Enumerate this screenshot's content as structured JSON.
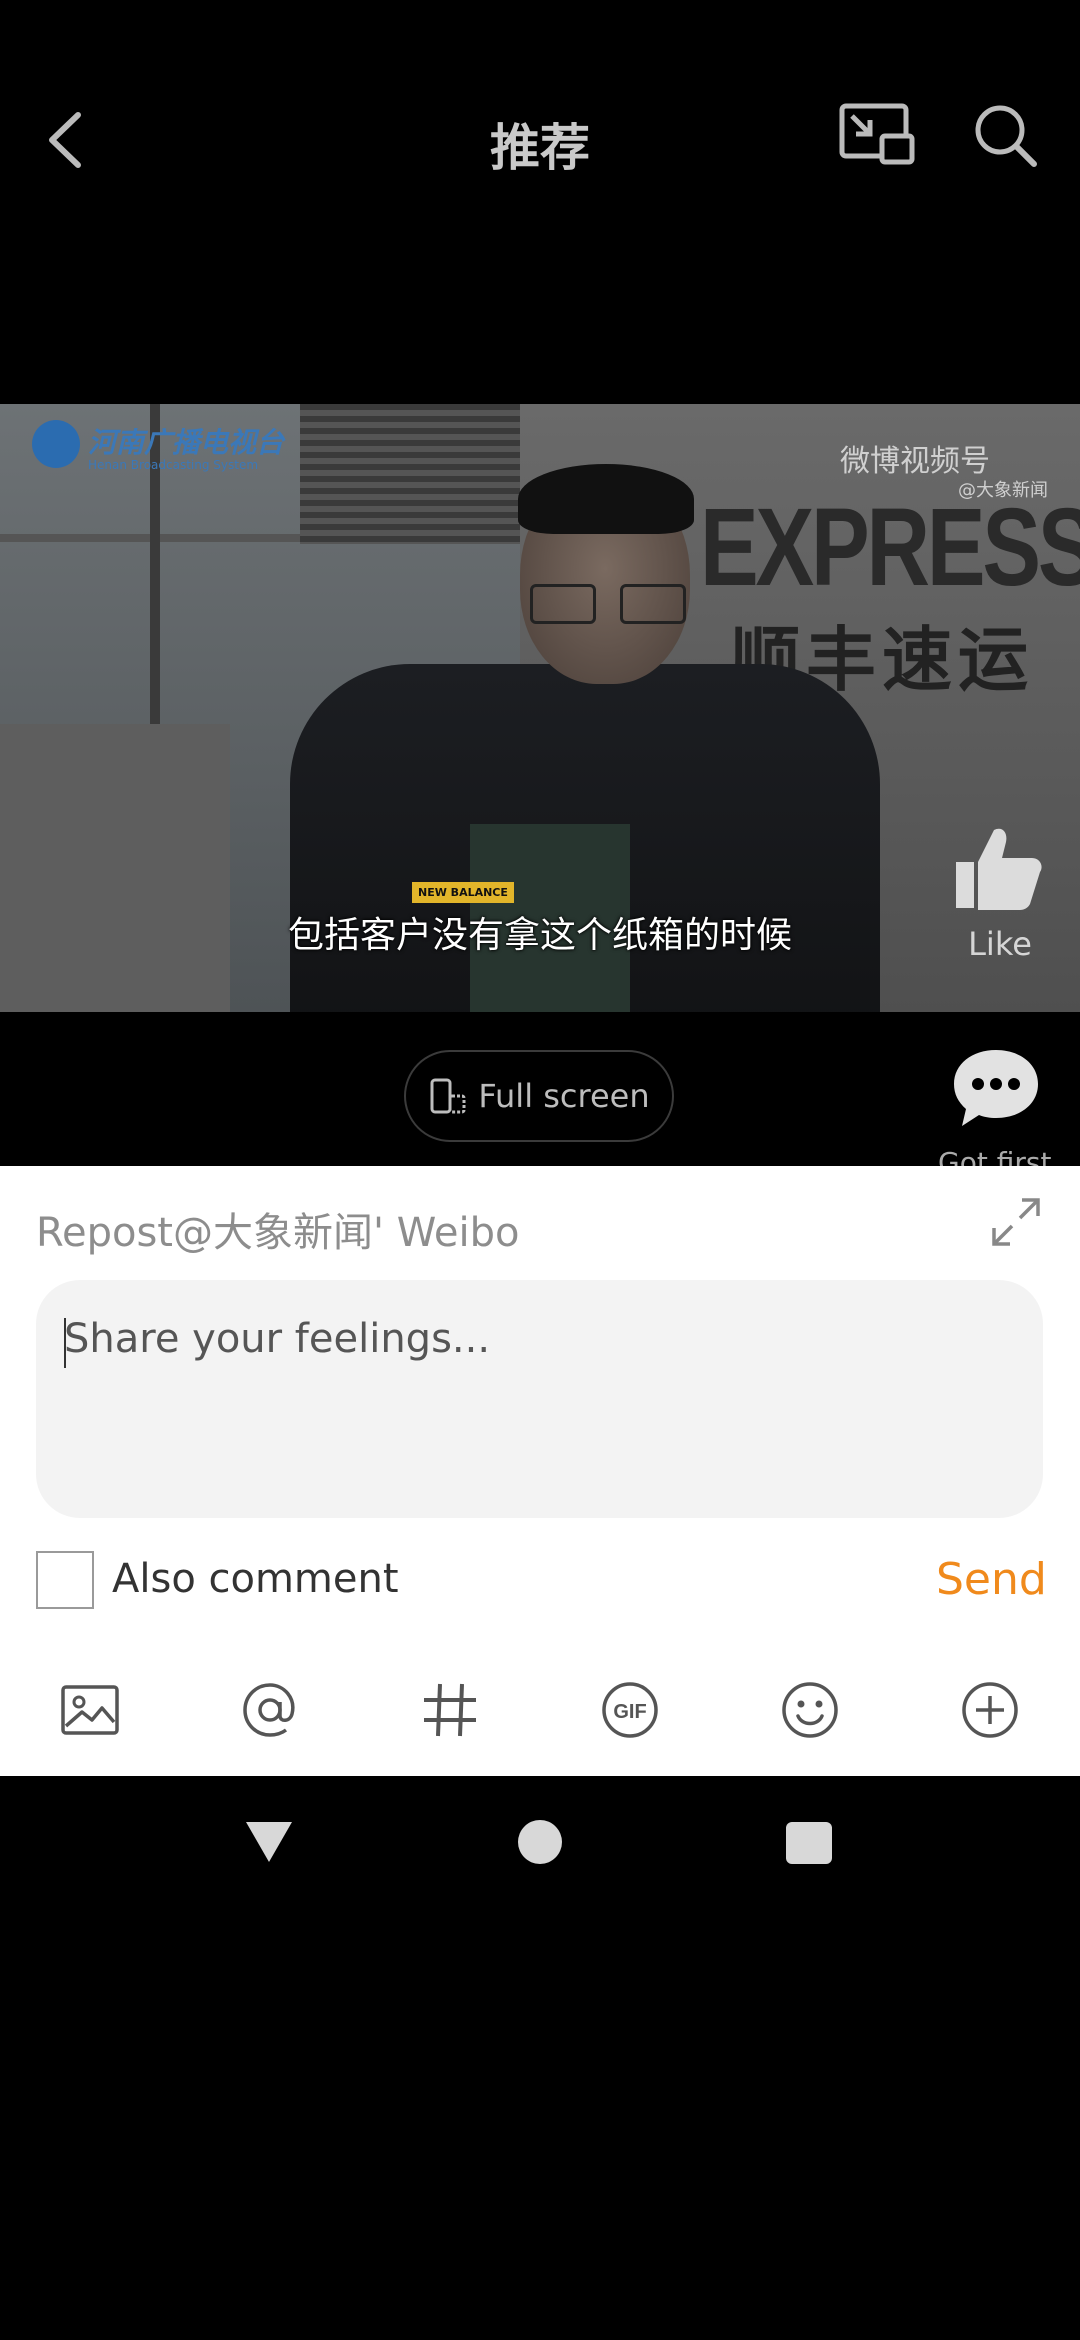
{
  "header": {
    "title": "推荐"
  },
  "video": {
    "subtitle": "包括客户没有拿这个纸箱的时候",
    "logo_left": "河南广播电视台",
    "logo_left_sub": "Henan Broadcasting System",
    "logo_right": "微博视频号",
    "logo_right_sub": "@大象新闻",
    "wall_sign": "EXPRESS",
    "wall_sign_cn": "顺丰速运",
    "badge_text": "NEW BALANCE"
  },
  "actions": {
    "like_label": "Like",
    "fullscreen_label": "Full screen",
    "comment_label": "Got first"
  },
  "repost": {
    "title": "Repost@大象新闻' Weibo",
    "placeholder": "Share your feelings...",
    "value": "",
    "also_comment_label": "Also comment",
    "also_comment_checked": false,
    "send_label": "Send",
    "send_color": "#f08a1c"
  },
  "toolbar": {
    "icons": [
      "image-icon",
      "at-mention-icon",
      "hashtag-icon",
      "gif-icon",
      "emoji-icon",
      "more-plus-icon"
    ]
  }
}
